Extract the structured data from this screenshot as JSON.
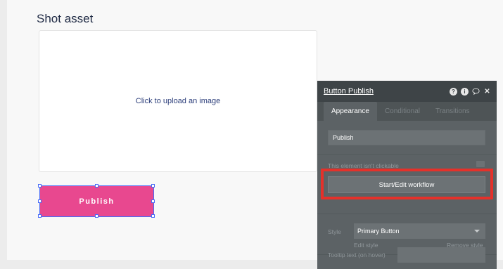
{
  "page": {
    "title": "Shot asset",
    "uploader_text": "Click to upload an image",
    "publish_button_label": "Publish"
  },
  "panel": {
    "title": "Button Publish",
    "header_icons": [
      "help-icon",
      "info-icon",
      "comment-icon",
      "close-icon"
    ],
    "tabs": [
      {
        "label": "Appearance",
        "active": true
      },
      {
        "label": "Conditional",
        "active": false
      },
      {
        "label": "Transitions",
        "active": false
      }
    ],
    "text_value": "Publish",
    "not_clickable_label": "This element isn't clickable",
    "workflow_button": "Start/Edit workflow",
    "style_label": "Style",
    "style_value": "Primary Button",
    "edit_style": "Edit style",
    "remove_style": "Remove style",
    "tooltip_label": "Tooltip text (on hover)",
    "tooltip_value": ""
  },
  "colors": {
    "publish_button": "#e8488f",
    "highlight": "#e5312a",
    "panel_background": "#5c6265"
  }
}
